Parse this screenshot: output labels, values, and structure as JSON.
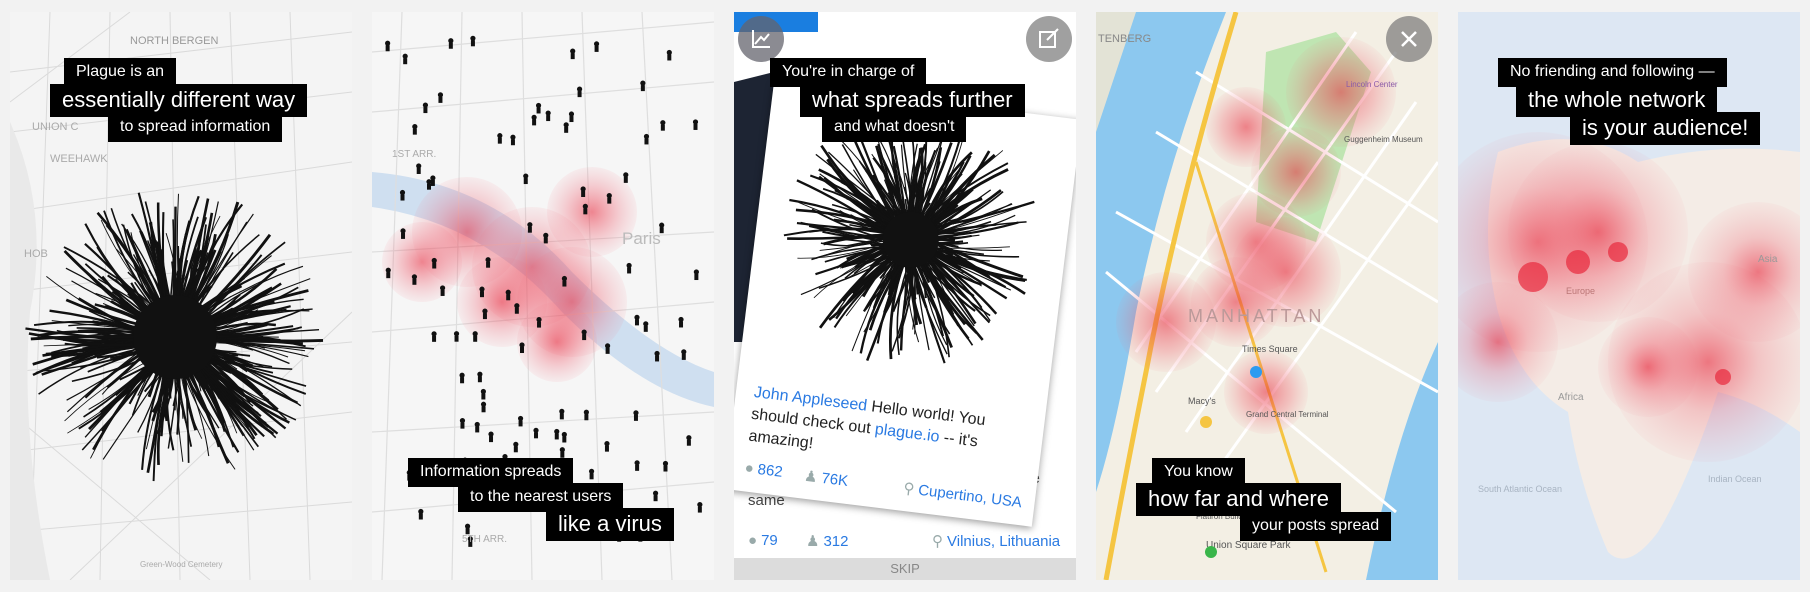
{
  "panel1": {
    "lines": [
      "Plague is an",
      "essentially different way",
      "to spread information"
    ],
    "map_labels": [
      "NORTH BERGEN",
      "UNION C",
      "WEEHAWK",
      "HOB",
      "Green-Wood Cemetery"
    ]
  },
  "panel2": {
    "lines": [
      "Information spreads",
      "to the nearest users",
      "like a virus"
    ],
    "map_labels": [
      "1ST ARR.",
      "Paris",
      "5TH ARR."
    ]
  },
  "panel3": {
    "lines": [
      "You're in charge of",
      "what spreads further",
      "and what doesn't"
    ],
    "post_author": "John Appleseed",
    "post_text_1": " Hello world! You should check out ",
    "post_link": "plague.io",
    "post_text_2": " -- it's amazing!",
    "comments": "862",
    "spreads": "76K",
    "location": "Cupertino, USA",
    "behind_text": "existence and the sa... etc, Europe uses the same",
    "comments_2": "79",
    "spreads_2": "312",
    "location_2": "Vilnius, Lithuania",
    "skip_label": "SKIP"
  },
  "panel4": {
    "lines": [
      "You know",
      "how far and where",
      "your posts spread"
    ],
    "map_labels": [
      "TENBERG",
      "MANHATTAN",
      "Times Square",
      "Grand Central Terminal",
      "Union Square Park",
      "Flatiron Building",
      "Macy's",
      "Guggenheim Museum",
      "Lincoln Center"
    ]
  },
  "panel5": {
    "lines": [
      "No friending and following —",
      "the whole network",
      "is your audience!"
    ],
    "map_labels": [
      "Europe",
      "Africa",
      "Asia",
      "South Atlantic Ocean",
      "Indian Ocean"
    ]
  },
  "colors": {
    "heat": "#e8283c",
    "caption_bg": "#000000",
    "link": "#2a7ae2",
    "water": "#8cc8ef",
    "highway": "#f5c542"
  }
}
